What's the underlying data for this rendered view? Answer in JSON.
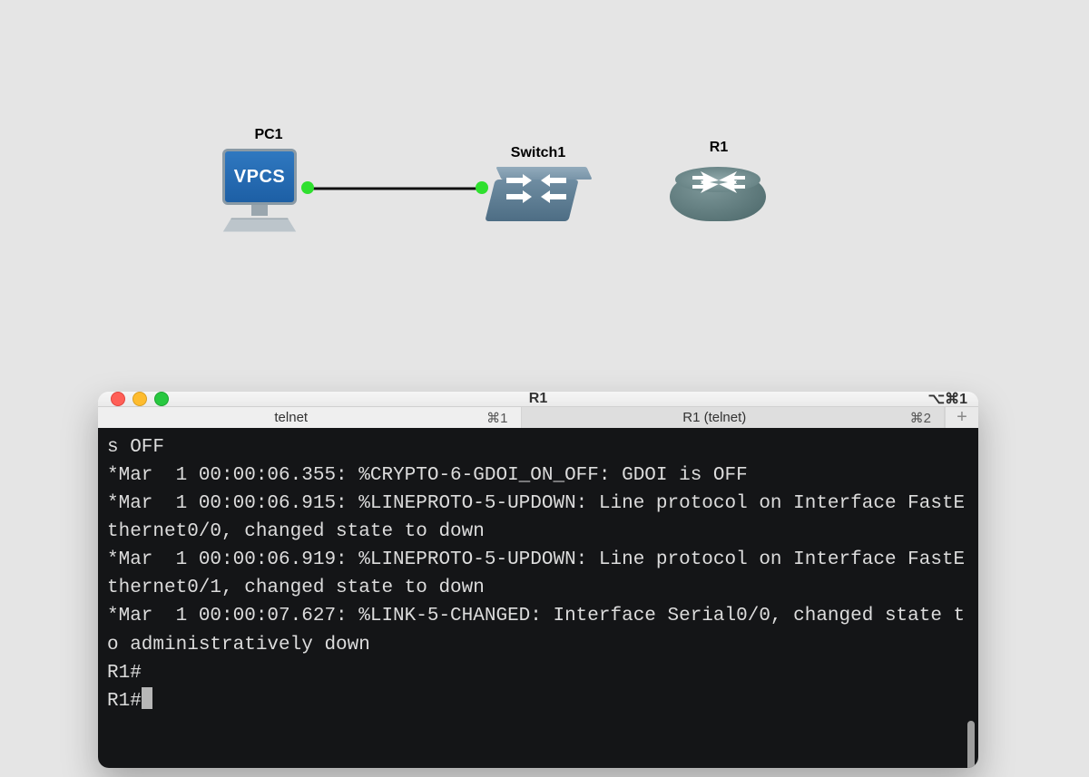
{
  "topology": {
    "nodes": {
      "pc1": {
        "label": "PC1",
        "screen_text": "VPCS"
      },
      "sw1": {
        "label": "Switch1"
      },
      "r1": {
        "label": "R1"
      }
    },
    "links": [
      {
        "from": "pc1",
        "to": "sw1",
        "status": "up"
      }
    ]
  },
  "terminal": {
    "window_title": "R1",
    "window_shortcut": "⌥⌘1",
    "tabs": [
      {
        "label": "telnet",
        "shortcut": "⌘1",
        "active": false
      },
      {
        "label": "R1 (telnet)",
        "shortcut": "⌘2",
        "active": true
      }
    ],
    "add_tab_glyph": "+",
    "lines": [
      "s OFF",
      "*Mar  1 00:00:06.355: %CRYPTO-6-GDOI_ON_OFF: GDOI is OFF",
      "*Mar  1 00:00:06.915: %LINEPROTO-5-UPDOWN: Line protocol on Interface FastEthernet0/0, changed state to down",
      "*Mar  1 00:00:06.919: %LINEPROTO-5-UPDOWN: Line protocol on Interface FastEthernet0/1, changed state to down",
      "*Mar  1 00:00:07.627: %LINK-5-CHANGED: Interface Serial0/0, changed state to administratively down",
      "R1#",
      "R1#"
    ]
  }
}
